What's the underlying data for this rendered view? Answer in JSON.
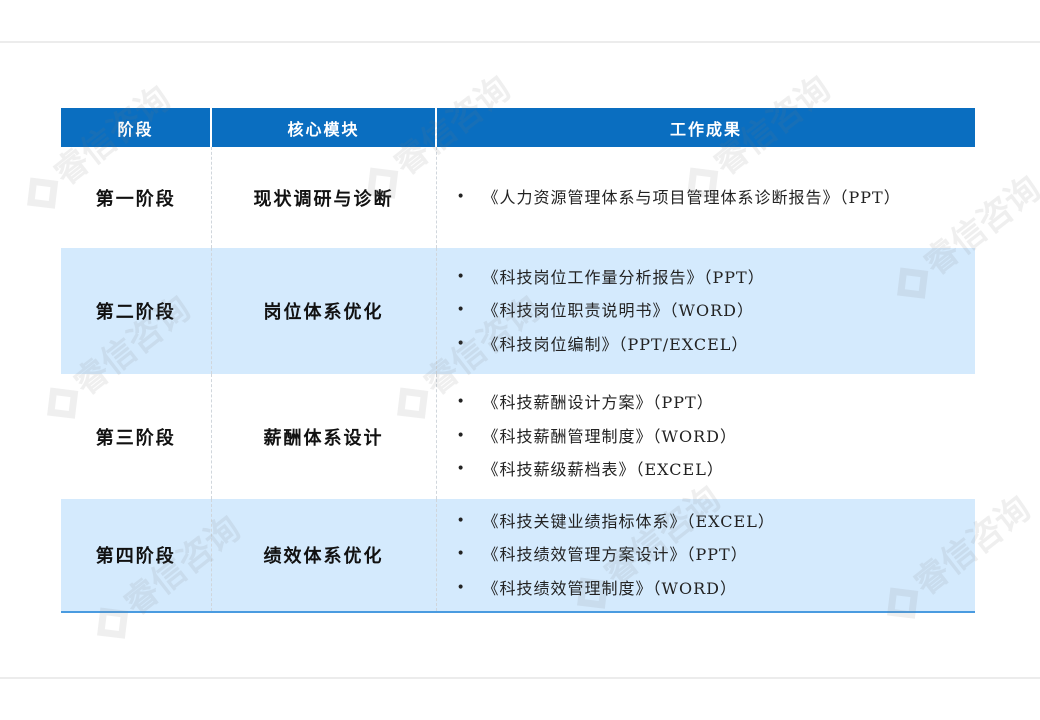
{
  "table": {
    "headers": [
      "阶段",
      "核心模块",
      "工作成果"
    ],
    "rows": [
      {
        "stage": "第一阶段",
        "module": "现状调研与诊断",
        "results": [
          "《人力资源管理体系与项目管理体系诊断报告》（PPT）"
        ]
      },
      {
        "stage": "第二阶段",
        "module": "岗位体系优化",
        "results": [
          "《科技岗位工作量分析报告》（PPT）",
          "《科技岗位职责说明书》（WORD）",
          "《科技岗位编制》（PPT/EXCEL）"
        ]
      },
      {
        "stage": "第三阶段",
        "module": "薪酬体系设计",
        "results": [
          "《科技薪酬设计方案》（PPT）",
          "《科技薪酬管理制度》（WORD）",
          "《科技薪级薪档表》（EXCEL）"
        ]
      },
      {
        "stage": "第四阶段",
        "module": "绩效体系优化",
        "results": [
          "《科技关键业绩指标体系》（EXCEL）",
          "《科技绩效管理方案设计》（PPT）",
          "《科技绩效管理制度》（WORD）"
        ]
      }
    ]
  },
  "watermark": "睿信咨询",
  "colors": {
    "header_bg": "#0a6ec0",
    "alt_row_bg": "#d4eafd",
    "bottom_border": "#4a9be0"
  }
}
